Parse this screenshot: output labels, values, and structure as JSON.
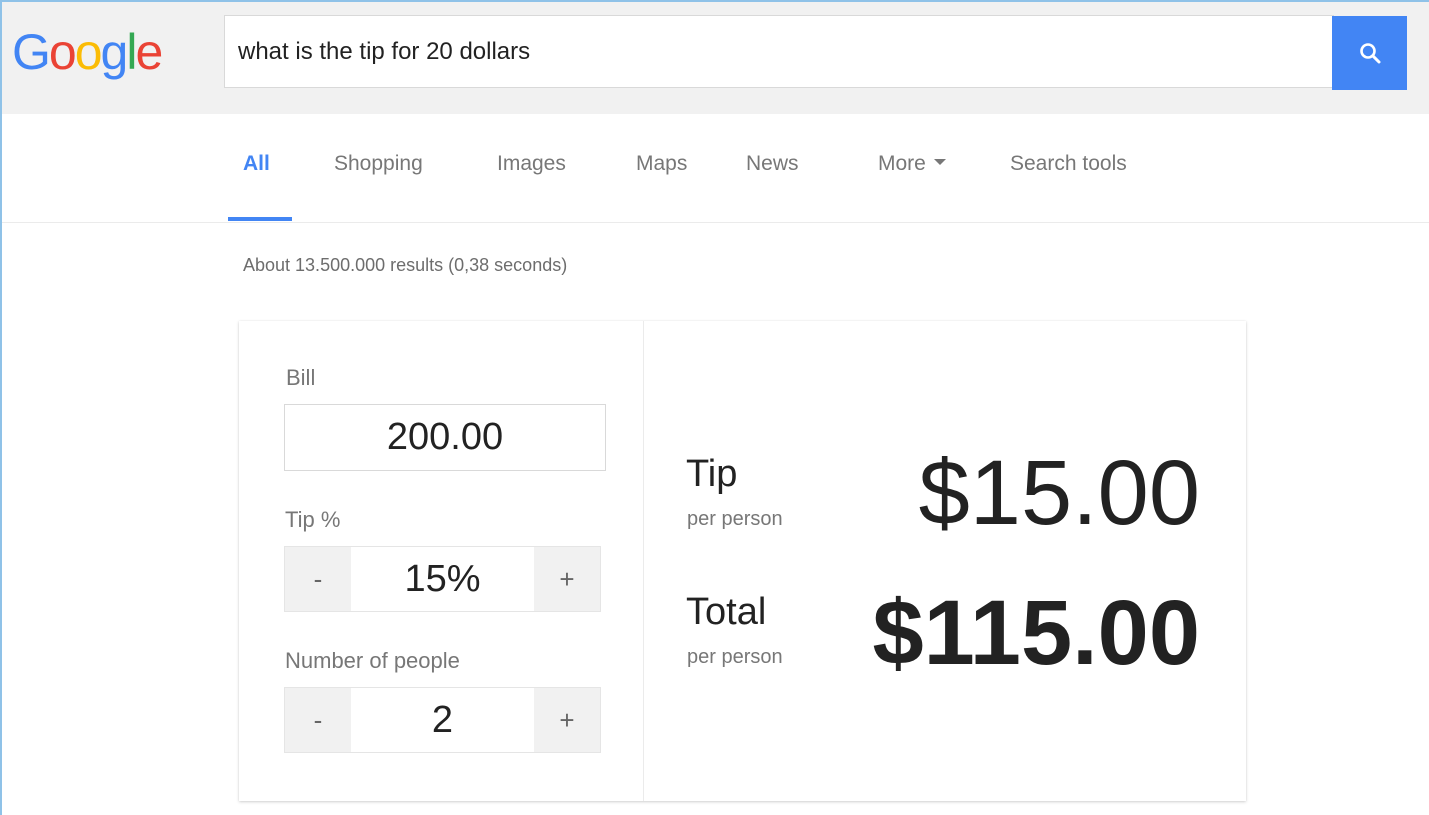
{
  "colors": {
    "accent": "#4285f4",
    "logo": [
      "#4285f4",
      "#ea4335",
      "#fbbc05",
      "#4285f4",
      "#34a853",
      "#ea4335"
    ]
  },
  "header": {
    "logo_letters": [
      "G",
      "o",
      "o",
      "g",
      "l",
      "e"
    ],
    "search_query": "what is the tip for 20 dollars",
    "search_button_icon": "search-icon"
  },
  "nav": {
    "tabs": [
      {
        "label": "All",
        "active": true
      },
      {
        "label": "Shopping"
      },
      {
        "label": "Images"
      },
      {
        "label": "Maps"
      },
      {
        "label": "News"
      },
      {
        "label": "More"
      },
      {
        "label": "Search tools"
      }
    ]
  },
  "results_count": "About 13.500.000 results (0,38 seconds)",
  "calculator": {
    "bill_label": "Bill",
    "bill_value": "200.00",
    "tip_label": "Tip %",
    "tip_value": "15%",
    "people_label": "Number of people",
    "people_value": "2",
    "minus": "-",
    "plus": "+",
    "tip_result_label": "Tip",
    "tip_result_sub": "per person",
    "tip_result_amount": "$15.00",
    "total_result_label": "Total",
    "total_result_sub": "per person",
    "total_result_amount": "$115.00"
  }
}
